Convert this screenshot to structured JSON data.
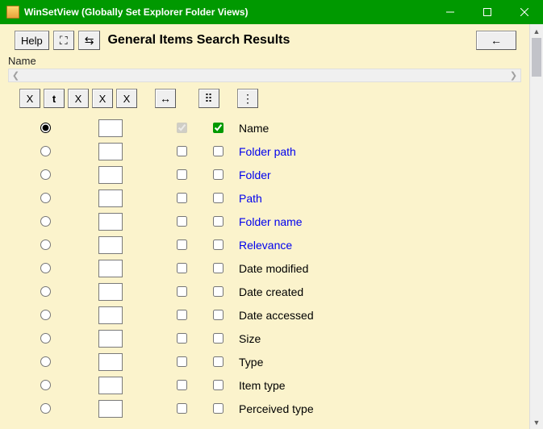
{
  "window": {
    "title": "WinSetView (Globally Set Explorer Folder Views)"
  },
  "toolbar": {
    "help_label": "Help",
    "fullscreen_tip": "⛶",
    "swap_tip": "⇆",
    "section_title": "General Items Search Results",
    "back_label": "←"
  },
  "header": {
    "name_label": "Name"
  },
  "buttonstrip": {
    "b1": "X",
    "b2": "t",
    "b3": "X",
    "b4": "X",
    "b5": "X",
    "b6": "↔",
    "b7": "⠿",
    "b8": "⋮"
  },
  "rows": [
    {
      "label": "Name",
      "link": false,
      "radio": true,
      "input": "",
      "cb1": true,
      "cb2": true,
      "cb1_disabled": true
    },
    {
      "label": "Folder path",
      "link": true,
      "radio": false,
      "input": "",
      "cb1": false,
      "cb2": false,
      "cb1_disabled": false
    },
    {
      "label": "Folder",
      "link": true,
      "radio": false,
      "input": "",
      "cb1": false,
      "cb2": false,
      "cb1_disabled": false
    },
    {
      "label": "Path",
      "link": true,
      "radio": false,
      "input": "",
      "cb1": false,
      "cb2": false,
      "cb1_disabled": false
    },
    {
      "label": "Folder name",
      "link": true,
      "radio": false,
      "input": "",
      "cb1": false,
      "cb2": false,
      "cb1_disabled": false
    },
    {
      "label": "Relevance",
      "link": true,
      "radio": false,
      "input": "",
      "cb1": false,
      "cb2": false,
      "cb1_disabled": false
    },
    {
      "label": "Date modified",
      "link": false,
      "radio": false,
      "input": "",
      "cb1": false,
      "cb2": false,
      "cb1_disabled": false
    },
    {
      "label": "Date created",
      "link": false,
      "radio": false,
      "input": "",
      "cb1": false,
      "cb2": false,
      "cb1_disabled": false
    },
    {
      "label": "Date accessed",
      "link": false,
      "radio": false,
      "input": "",
      "cb1": false,
      "cb2": false,
      "cb1_disabled": false
    },
    {
      "label": "Size",
      "link": false,
      "radio": false,
      "input": "",
      "cb1": false,
      "cb2": false,
      "cb1_disabled": false
    },
    {
      "label": "Type",
      "link": false,
      "radio": false,
      "input": "",
      "cb1": false,
      "cb2": false,
      "cb1_disabled": false
    },
    {
      "label": "Item type",
      "link": false,
      "radio": false,
      "input": "",
      "cb1": false,
      "cb2": false,
      "cb1_disabled": false
    },
    {
      "label": "Perceived type",
      "link": false,
      "radio": false,
      "input": "",
      "cb1": false,
      "cb2": false,
      "cb1_disabled": false
    }
  ]
}
